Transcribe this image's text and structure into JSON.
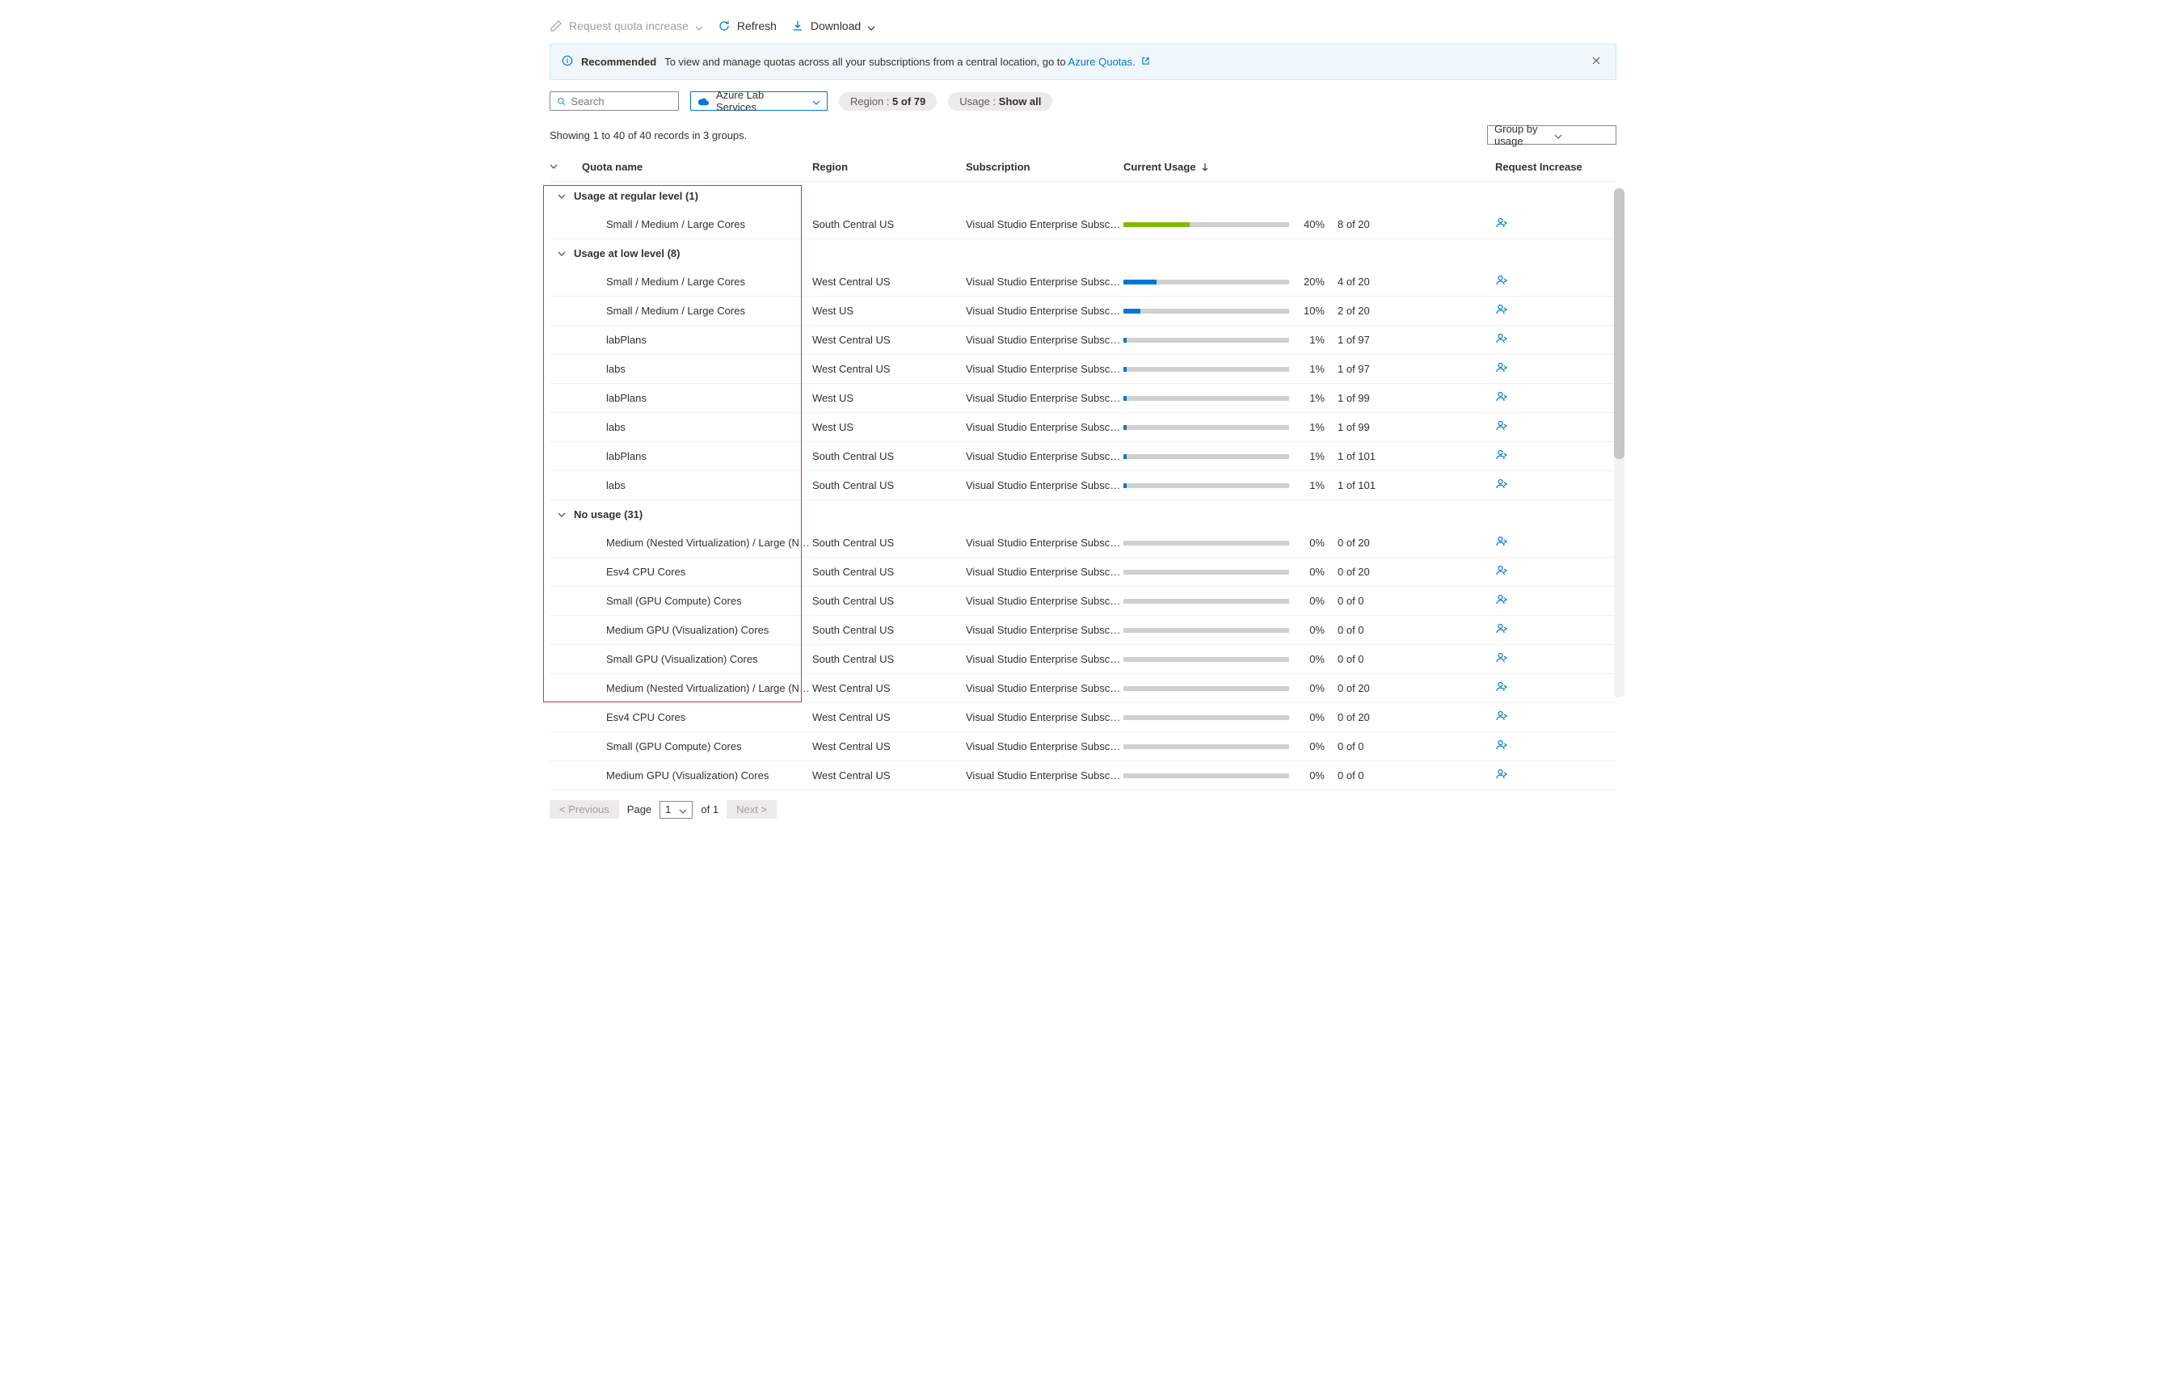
{
  "toolbar": {
    "request_increase": "Request quota increase",
    "refresh": "Refresh",
    "download": "Download"
  },
  "banner": {
    "label": "Recommended",
    "text": "To view and manage quotas across all your subscriptions from a central location, go to ",
    "link": "Azure Quotas."
  },
  "filters": {
    "search_placeholder": "Search",
    "provider": "Azure Lab Services",
    "region": {
      "label": "Region : ",
      "value": "5 of 79"
    },
    "usage": {
      "label": "Usage : ",
      "value": "Show all"
    }
  },
  "summary": "Showing 1 to 40 of 40 records in 3 groups.",
  "group_by": "Group by usage",
  "headers": {
    "name": "Quota name",
    "region": "Region",
    "subscription": "Subscription",
    "usage": "Current Usage",
    "request": "Request Increase"
  },
  "groups": [
    {
      "title": "Usage at regular level (1)",
      "rows": [
        {
          "name": "Small / Medium / Large Cores",
          "region": "South Central US",
          "sub": "Visual Studio Enterprise Subscri…",
          "pct": 40,
          "pct_label": "40%",
          "count": "8 of 20",
          "color": "green"
        }
      ]
    },
    {
      "title": "Usage at low level (8)",
      "rows": [
        {
          "name": "Small / Medium / Large Cores",
          "region": "West Central US",
          "sub": "Visual Studio Enterprise Subscri…",
          "pct": 20,
          "pct_label": "20%",
          "count": "4 of 20",
          "color": "blue"
        },
        {
          "name": "Small / Medium / Large Cores",
          "region": "West US",
          "sub": "Visual Studio Enterprise Subscri…",
          "pct": 10,
          "pct_label": "10%",
          "count": "2 of 20",
          "color": "blue"
        },
        {
          "name": "labPlans",
          "region": "West Central US",
          "sub": "Visual Studio Enterprise Subscri…",
          "pct": 1,
          "pct_label": "1%",
          "count": "1 of 97",
          "color": "blue"
        },
        {
          "name": "labs",
          "region": "West Central US",
          "sub": "Visual Studio Enterprise Subscri…",
          "pct": 1,
          "pct_label": "1%",
          "count": "1 of 97",
          "color": "blue"
        },
        {
          "name": "labPlans",
          "region": "West US",
          "sub": "Visual Studio Enterprise Subscri…",
          "pct": 1,
          "pct_label": "1%",
          "count": "1 of 99",
          "color": "blue"
        },
        {
          "name": "labs",
          "region": "West US",
          "sub": "Visual Studio Enterprise Subscri…",
          "pct": 1,
          "pct_label": "1%",
          "count": "1 of 99",
          "color": "blue"
        },
        {
          "name": "labPlans",
          "region": "South Central US",
          "sub": "Visual Studio Enterprise Subscri…",
          "pct": 1,
          "pct_label": "1%",
          "count": "1 of 101",
          "color": "blue"
        },
        {
          "name": "labs",
          "region": "South Central US",
          "sub": "Visual Studio Enterprise Subscri…",
          "pct": 1,
          "pct_label": "1%",
          "count": "1 of 101",
          "color": "blue"
        }
      ]
    },
    {
      "title": "No usage (31)",
      "rows": [
        {
          "name": "Medium (Nested Virtualization) / Large (Nested …",
          "region": "South Central US",
          "sub": "Visual Studio Enterprise Subscri…",
          "pct": 0,
          "pct_label": "0%",
          "count": "0 of 20",
          "color": "blue"
        },
        {
          "name": "Esv4 CPU Cores",
          "region": "South Central US",
          "sub": "Visual Studio Enterprise Subscri…",
          "pct": 0,
          "pct_label": "0%",
          "count": "0 of 20",
          "color": "blue"
        },
        {
          "name": "Small (GPU Compute) Cores",
          "region": "South Central US",
          "sub": "Visual Studio Enterprise Subscri…",
          "pct": 0,
          "pct_label": "0%",
          "count": "0 of 0",
          "color": "blue"
        },
        {
          "name": "Medium GPU (Visualization) Cores",
          "region": "South Central US",
          "sub": "Visual Studio Enterprise Subscri…",
          "pct": 0,
          "pct_label": "0%",
          "count": "0 of 0",
          "color": "blue"
        },
        {
          "name": "Small GPU (Visualization) Cores",
          "region": "South Central US",
          "sub": "Visual Studio Enterprise Subscri…",
          "pct": 0,
          "pct_label": "0%",
          "count": "0 of 0",
          "color": "blue"
        },
        {
          "name": "Medium (Nested Virtualization) / Large (Nested …",
          "region": "West Central US",
          "sub": "Visual Studio Enterprise Subscri…",
          "pct": 0,
          "pct_label": "0%",
          "count": "0 of 20",
          "color": "blue"
        },
        {
          "name": "Esv4 CPU Cores",
          "region": "West Central US",
          "sub": "Visual Studio Enterprise Subscri…",
          "pct": 0,
          "pct_label": "0%",
          "count": "0 of 20",
          "color": "blue"
        },
        {
          "name": "Small (GPU Compute) Cores",
          "region": "West Central US",
          "sub": "Visual Studio Enterprise Subscri…",
          "pct": 0,
          "pct_label": "0%",
          "count": "0 of 0",
          "color": "blue"
        },
        {
          "name": "Medium GPU (Visualization) Cores",
          "region": "West Central US",
          "sub": "Visual Studio Enterprise Subscri…",
          "pct": 0,
          "pct_label": "0%",
          "count": "0 of 0",
          "color": "blue"
        }
      ]
    }
  ],
  "pagination": {
    "prev": "< Previous",
    "page_label": "Page",
    "page_current": "1",
    "of": "of 1",
    "next": "Next >"
  }
}
